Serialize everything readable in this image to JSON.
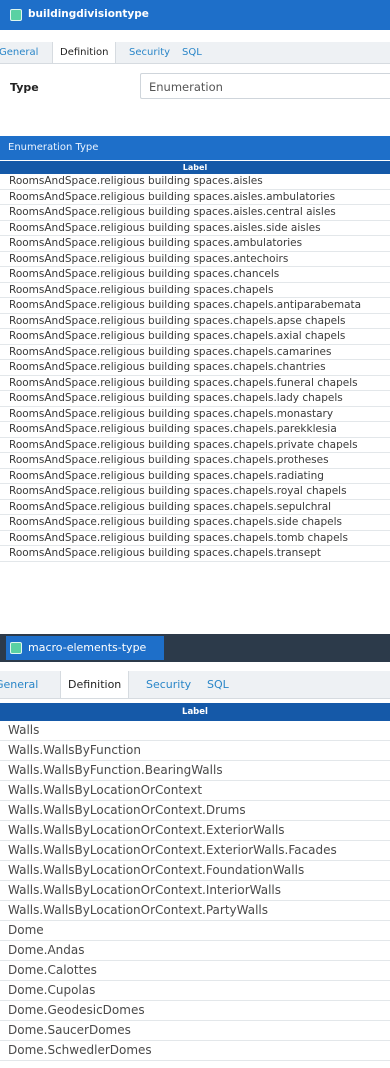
{
  "panel1": {
    "title": "buildingdivisiontype",
    "tabs": [
      "General",
      "Definition",
      "Security",
      "SQL"
    ],
    "active_tab": "Definition",
    "type_label": "Type",
    "type_value": "Enumeration",
    "section_title": "Enumeration Type",
    "column_header": "Label",
    "rows": [
      "RoomsAndSpace.religious building spaces.aisles",
      "RoomsAndSpace.religious building spaces.aisles.ambulatories",
      "RoomsAndSpace.religious building spaces.aisles.central aisles",
      "RoomsAndSpace.religious building spaces.aisles.side aisles",
      "RoomsAndSpace.religious building spaces.ambulatories",
      "RoomsAndSpace.religious building spaces.antechoirs",
      "RoomsAndSpace.religious building spaces.chancels",
      "RoomsAndSpace.religious building spaces.chapels",
      "RoomsAndSpace.religious building spaces.chapels.antiparabemata",
      "RoomsAndSpace.religious building spaces.chapels.apse chapels",
      "RoomsAndSpace.religious building spaces.chapels.axial chapels",
      "RoomsAndSpace.religious building spaces.chapels.camarines",
      "RoomsAndSpace.religious building spaces.chapels.chantries",
      "RoomsAndSpace.religious building spaces.chapels.funeral chapels",
      "RoomsAndSpace.religious building spaces.chapels.lady chapels",
      "RoomsAndSpace.religious building spaces.chapels.monastary",
      "RoomsAndSpace.religious building spaces.chapels.parekklesia",
      "RoomsAndSpace.religious building spaces.chapels.private chapels",
      "RoomsAndSpace.religious building spaces.chapels.protheses",
      "RoomsAndSpace.religious building spaces.chapels.radiating",
      "RoomsAndSpace.religious building spaces.chapels.royal chapels",
      "RoomsAndSpace.religious building spaces.chapels.sepulchral",
      "RoomsAndSpace.religious building spaces.chapels.side chapels",
      "RoomsAndSpace.religious building spaces.chapels.tomb chapels",
      "RoomsAndSpace.religious building spaces.chapels.transept"
    ]
  },
  "panel2": {
    "title": "macro-elements-type",
    "tabs": [
      "General",
      "Definition",
      "Security",
      "SQL"
    ],
    "active_tab": "Definition",
    "column_header": "Label",
    "rows": [
      "Walls",
      "Walls.WallsByFunction",
      "Walls.WallsByFunction.BearingWalls",
      "Walls.WallsByLocationOrContext",
      "Walls.WallsByLocationOrContext.Drums",
      "Walls.WallsByLocationOrContext.ExteriorWalls",
      "Walls.WallsByLocationOrContext.ExteriorWalls.Facades",
      "Walls.WallsByLocationOrContext.FoundationWalls",
      "Walls.WallsByLocationOrContext.InteriorWalls",
      "Walls.WallsByLocationOrContext.PartyWalls",
      "Dome",
      "Dome.Andas",
      "Dome.Calottes",
      "Dome.Cupolas",
      "Dome.GeodesicDomes",
      "Dome.SaucerDomes",
      "Dome.SchwedlerDomes"
    ]
  },
  "colors": {
    "header_blue": "#1e6fc9",
    "column_header_blue": "#1559a8",
    "tab_link": "#2a86c8",
    "icon_green": "#5ad1a3"
  },
  "icons": {
    "panel_icon": "table-icon"
  }
}
